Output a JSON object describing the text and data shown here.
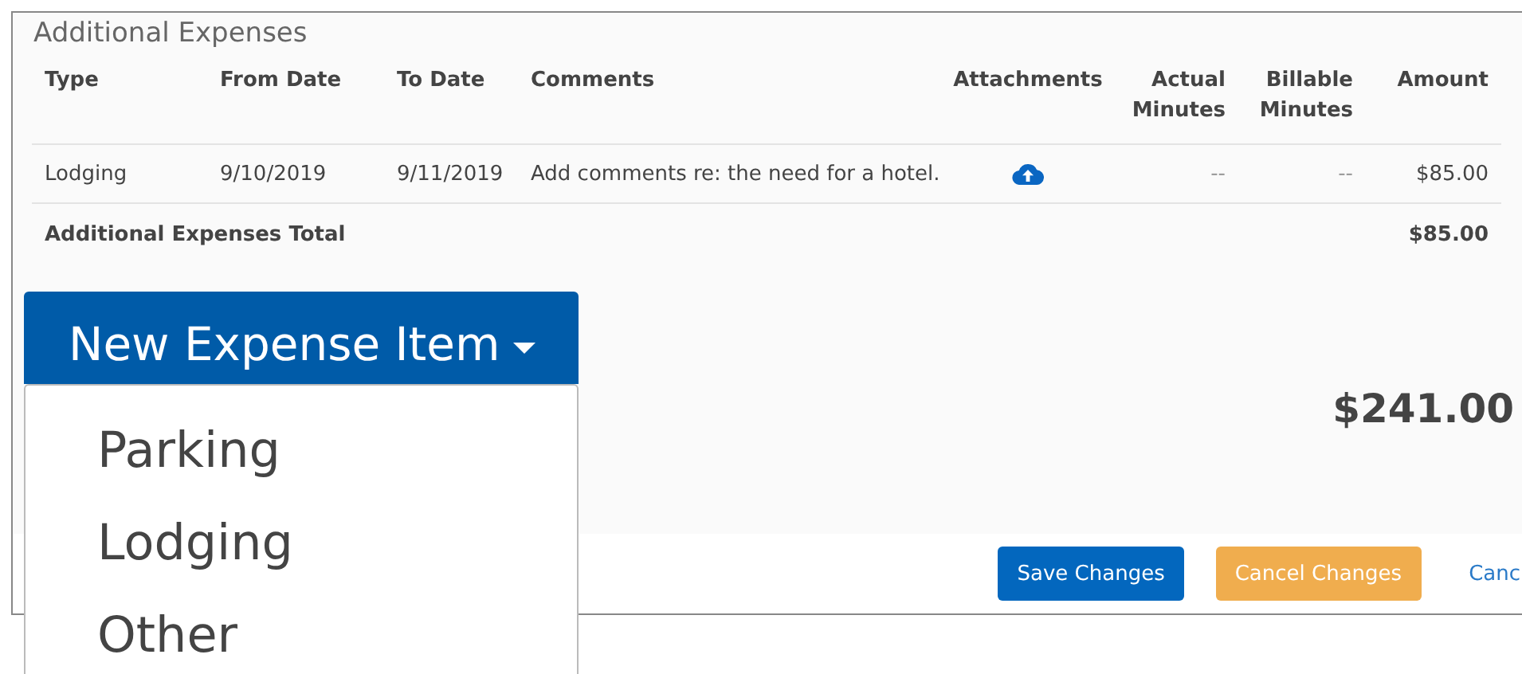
{
  "section": {
    "title": "Additional Expenses"
  },
  "table": {
    "columns": [
      "Type",
      "From Date",
      "To Date",
      "Comments",
      "Attachments",
      "Actual Minutes",
      "Billable Minutes",
      "Amount"
    ],
    "rows": [
      {
        "type": "Lodging",
        "from_date": "9/10/2019",
        "to_date": "9/11/2019",
        "comments": "Add comments re: the need for a hotel.",
        "attachment": true,
        "actual_minutes": "--",
        "billable_minutes": "--",
        "amount": "$85.00"
      }
    ],
    "total": {
      "label": "Additional Expenses Total",
      "amount": "$85.00"
    }
  },
  "grand_total": "$241.00",
  "buttons": [
    {
      "kind": "primary",
      "label": "Save Changes"
    },
    {
      "kind": "warning",
      "label": "Cancel Changes"
    },
    {
      "kind": "link",
      "label": "Canc"
    }
  ],
  "dropdown": {
    "label": "New Expense Item",
    "expanded": true,
    "items": [
      "Parking",
      "Lodging",
      "Other"
    ]
  }
}
